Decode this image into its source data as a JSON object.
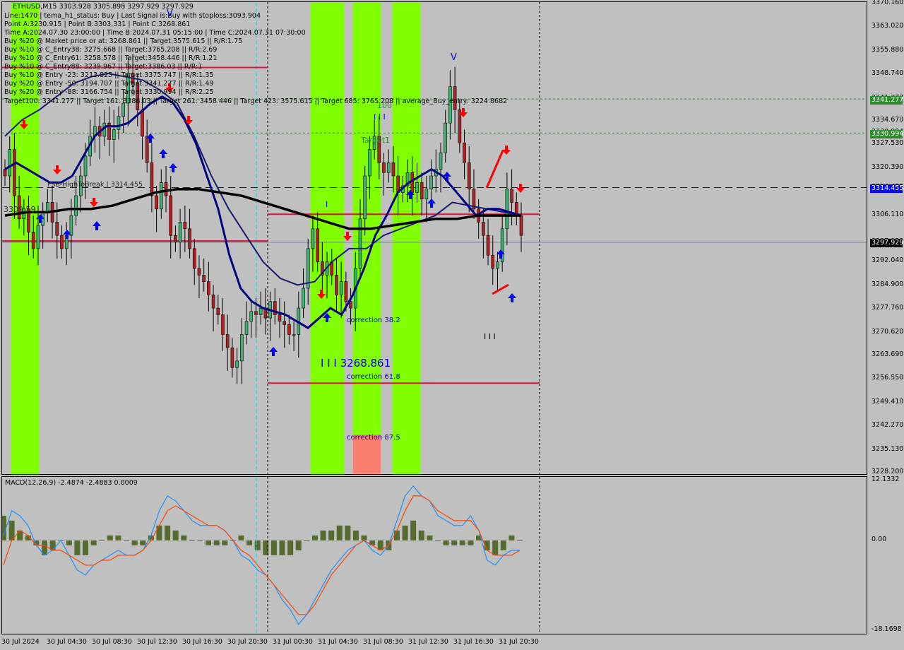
{
  "header": {
    "symbol_line": "ETHUSD,M15  3303.928 3305.898 3297.929 3297.929",
    "lines": [
      "Line:1470 | tema_h1_status: Buy | Last Signal is:Buy with stoploss:3093.904",
      "Point A:3230.915 | Point B:3303.331 | Point C:3268.861",
      "Time A:2024.07.30 23:00:00 | Time B:2024.07.31 05:15:00 | Time C:2024.07.31 07:30:00",
      "Buy %20 @ Market price or at: 3268.861 || Target:3575.615 || R/R:1.75",
      "Buy %10 @ C_Entry38: 3275.668 || Target:3765.208 || R/R:2.69",
      "Buy %10 @ C_Entry61: 3258.578 || Target:3458.446 || R/R:1.21",
      "Buy %10 @ C_Entry88: 3239.967 || Target:3386.03 || R/R:1",
      "Buy %10 @ Entry -23: 3213.825 || Target:3375.747 || R/R:1.35",
      "Buy %20 @ Entry -50: 3194.707 || Target:3341.277 || R/R:1.49",
      "Buy %20 @ Entry -88: 3166.754 || Target:3330.994 || R/R:2.25",
      "Target100: 3341.277 || Target 161: 3386.03 || Target 261: 3458.446 || Target 423: 3575.615 || Target 685: 3765.208 || average_Buy_entry: 3224.8682"
    ]
  },
  "annotations": {
    "fsb_label": "FSB-HighToBreak | 3314.455",
    "level_3309": "3309.59",
    "target1": "Target1",
    "label_100": "100",
    "point_c": "I I I 3268.861",
    "corr382": "correction 38.2",
    "corr618": "correction 61.8",
    "corr875": "correction 87.5",
    "v_mark": "V",
    "bars_mark": "I I I",
    "i_mark": "I"
  },
  "badges": {
    "target100": {
      "text": "3341.277",
      "color": "#2e8b2e"
    },
    "target_avg": {
      "text": "3330.994",
      "color": "#2e8b2e"
    },
    "fsb": {
      "text": "3314.455",
      "color": "#0000ff"
    },
    "last_price": {
      "text": "3297.929",
      "color": "#000000"
    }
  },
  "chart_data": [
    {
      "type": "candlestick",
      "title": "ETHUSD,M15",
      "ohlc_last": {
        "open": 3303.928,
        "high": 3305.898,
        "low": 3297.929,
        "close": 3297.929
      },
      "ylim": [
        3228.2,
        3370.16
      ],
      "yticks": [
        "3370.160",
        "3363.020",
        "3355.880",
        "3348.740",
        "3341.277",
        "3334.670",
        "3330.994",
        "3327.530",
        "3320.390",
        "3314.455",
        "3306.110",
        "3297.929",
        "3292.040",
        "3284.900",
        "3277.760",
        "3270.620",
        "3263.690",
        "3256.550",
        "3249.410",
        "3242.270",
        "3235.130",
        "3228.200"
      ],
      "xticks": [
        "30 Jul 2024",
        "30 Jul 04:30",
        "30 Jul 08:30",
        "30 Jul 12:30",
        "30 Jul 16:30",
        "30 Jul 20:30",
        "31 Jul 00:30",
        "31 Jul 04:30",
        "31 Jul 08:30",
        "31 Jul 12:30",
        "31 Jul 16:30",
        "31 Jul 20:30"
      ],
      "levels": {
        "target100": 3341.277,
        "target_avg": 3330.994,
        "fsb_high_to_break": 3314.455,
        "point_b_line": 3306.4,
        "red_upper": 3350.8,
        "red_mid": 3298.3,
        "correction_618": 3255.3,
        "last_price": 3297.929
      },
      "close_series": [
        3318,
        3326,
        3312,
        3305,
        3308,
        3301,
        3296,
        3303,
        3307,
        3310,
        3304,
        3300,
        3296,
        3300,
        3306,
        3312,
        3318,
        3324,
        3330,
        3333,
        3330,
        3334,
        3329,
        3332,
        3336,
        3340,
        3349,
        3346,
        3338,
        3330,
        3322,
        3312,
        3308,
        3316,
        3312,
        3300,
        3298,
        3304,
        3302,
        3296,
        3290,
        3288,
        3286,
        3282,
        3278,
        3276,
        3270,
        3266,
        3260,
        3262,
        3270,
        3274,
        3277,
        3276,
        3278,
        3275,
        3280,
        3276,
        3274,
        3273,
        3270,
        3270,
        3278,
        3284,
        3296,
        3302,
        3292,
        3288,
        3292,
        3288,
        3282,
        3286,
        3280,
        3278,
        3290,
        3305,
        3318,
        3326,
        3330,
        3322,
        3319,
        3322,
        3318,
        3313,
        3315,
        3319,
        3313,
        3316,
        3311,
        3314,
        3318,
        3320,
        3325,
        3334,
        3345,
        3338,
        3328,
        3322,
        3314,
        3308,
        3304,
        3300,
        3294,
        3290,
        3292,
        3302,
        3314,
        3310,
        3306,
        3300
      ],
      "ma_fast": [
        3320,
        3322,
        3320,
        3318,
        3316,
        3316,
        3318,
        3324,
        3330,
        3333,
        3333,
        3334,
        3337,
        3340,
        3342,
        3340,
        3335,
        3328,
        3318,
        3308,
        3294,
        3284,
        3280,
        3278,
        3277,
        3276,
        3274,
        3272,
        3275,
        3278,
        3276,
        3282,
        3290,
        3300,
        3306,
        3313,
        3316,
        3318,
        3320,
        3318,
        3314,
        3310,
        3306,
        3308,
        3308,
        3307,
        3306
      ],
      "ma_mid": [
        3330,
        3335,
        3338,
        3342,
        3346,
        3348,
        3349,
        3348,
        3347,
        3344,
        3340,
        3330,
        3318,
        3308,
        3300,
        3292,
        3287,
        3285,
        3286,
        3292,
        3296,
        3296,
        3300,
        3302,
        3304,
        3306,
        3310,
        3309,
        3308,
        3307,
        3306
      ],
      "ma_slow": [
        3306,
        3307,
        3307,
        3308,
        3308,
        3309,
        3311,
        3313,
        3314,
        3314,
        3313,
        3312,
        3310,
        3308,
        3306,
        3304,
        3302,
        3302,
        3303,
        3304,
        3305,
        3305,
        3306,
        3306,
        3306
      ],
      "green_zones": [
        "30 Jul 00:00-01:00",
        "31 Jul 03:15-04:30",
        "31 Jul 06:15-07:30",
        "31 Jul 08:00-09:15"
      ]
    },
    {
      "type": "macd",
      "title": "MACD(12,26,9) -2.4874 -2.4883 0.0009",
      "params": [
        12,
        26,
        9
      ],
      "values": {
        "macd": -2.4874,
        "signal": -2.4883,
        "histogram": 0.0009
      },
      "ylim": [
        -18.1698,
        12.1332
      ],
      "yticks": [
        "12.1332",
        "0.00",
        "-18.1698"
      ],
      "macd_series": [
        1,
        6,
        5,
        3,
        -1,
        -3,
        -2,
        0,
        -3,
        -6,
        -7,
        -5,
        -4,
        -3,
        -2,
        -3,
        -3,
        -2,
        1,
        6,
        9,
        8,
        6,
        4,
        3,
        3,
        3,
        2,
        0,
        -3,
        -4,
        -6,
        -7,
        -9,
        -12,
        -14,
        -17,
        -15,
        -12,
        -9,
        -6,
        -4,
        -2,
        -1,
        0,
        -2,
        -3,
        -1,
        4,
        9,
        11,
        9,
        8,
        5,
        4,
        3,
        3,
        5,
        2,
        -4,
        -5,
        -3,
        -2,
        -2
      ],
      "signal_series": [
        -5,
        0,
        2,
        1,
        -1,
        -1,
        -2,
        -2,
        -3,
        -4,
        -5,
        -5,
        -4,
        -4,
        -3,
        -3,
        -3,
        -2,
        0,
        3,
        6,
        7,
        6,
        5,
        4,
        3,
        3,
        2,
        0,
        -2,
        -3,
        -5,
        -7,
        -9,
        -11,
        -13,
        -15,
        -15,
        -13,
        -10,
        -7,
        -5,
        -3,
        -1,
        0,
        -1,
        -2,
        -1,
        2,
        6,
        9,
        9,
        8,
        6,
        5,
        4,
        4,
        4,
        2,
        -2,
        -3,
        -3,
        -3,
        -2
      ],
      "histogram_series": [
        5,
        4,
        2,
        1,
        -1,
        -3,
        -2,
        0,
        -1,
        -3,
        -3,
        -1,
        0,
        1,
        1,
        0,
        -1,
        -1,
        1,
        3,
        3,
        2,
        1,
        0,
        0,
        -1,
        -1,
        -1,
        0,
        1,
        -1,
        -2,
        -3,
        -3,
        -3,
        -3,
        -2,
        0,
        1,
        2,
        2,
        3,
        3,
        2,
        1,
        -1,
        -2,
        -2,
        2,
        3,
        4,
        2,
        1,
        0,
        -1,
        -1,
        -1,
        -1,
        1,
        -2,
        -3,
        -2,
        1,
        0
      ]
    }
  ]
}
